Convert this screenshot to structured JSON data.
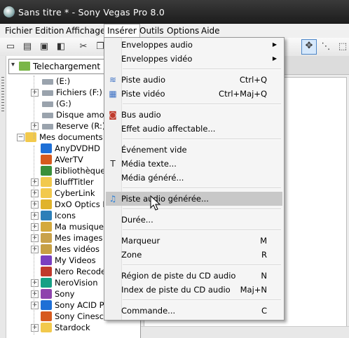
{
  "window": {
    "title": "Sans titre * - Sony Vegas Pro 8.0"
  },
  "menubar": [
    "Fichier",
    "Edition",
    "Affichage",
    "Insérer",
    "Outils",
    "Options",
    "Aide"
  ],
  "location": {
    "value": "Telechargement"
  },
  "tree": [
    {
      "label": "(E:)",
      "icon": "drive-icon",
      "expand": ""
    },
    {
      "label": "Fichiers (F:)",
      "icon": "drive-icon",
      "expand": "+"
    },
    {
      "label": "(G:)",
      "icon": "drive-icon",
      "expand": ""
    },
    {
      "label": "Disque amovi",
      "icon": "drive-icon",
      "expand": ""
    },
    {
      "label": "Reserve (R:)",
      "icon": "drive-icon",
      "expand": "+"
    },
    {
      "label": "Mes documents",
      "icon": "folder-icon",
      "expand": "-"
    },
    {
      "label": "AnyDVDHD",
      "icon": "app-icon",
      "expand": ""
    },
    {
      "label": "AVerTV",
      "icon": "app-icon",
      "expand": ""
    },
    {
      "label": "Bibliothèques",
      "icon": "app-icon",
      "expand": ""
    },
    {
      "label": "BluffTitler",
      "icon": "folder-icon",
      "expand": "+"
    },
    {
      "label": "CyberLink",
      "icon": "folder-icon",
      "expand": "+"
    },
    {
      "label": "DxO Optics P",
      "icon": "app-icon",
      "expand": "+"
    },
    {
      "label": "Icons",
      "icon": "app-icon",
      "expand": "+"
    },
    {
      "label": "Ma musique",
      "icon": "music-folder-icon",
      "expand": "+"
    },
    {
      "label": "Mes images",
      "icon": "pictures-folder-icon",
      "expand": "+"
    },
    {
      "label": "Mes vidéos",
      "icon": "videos-folder-icon",
      "expand": "+"
    },
    {
      "label": "My Videos",
      "icon": "app-icon",
      "expand": ""
    },
    {
      "label": "Nero Recode",
      "icon": "app-icon",
      "expand": ""
    },
    {
      "label": "NeroVision",
      "icon": "app-icon",
      "expand": "+"
    },
    {
      "label": "Sony",
      "icon": "app-icon",
      "expand": "+"
    },
    {
      "label": "Sony ACID Pr",
      "icon": "app-icon",
      "expand": "+"
    },
    {
      "label": "Sony Cinesco",
      "icon": "app-icon",
      "expand": ""
    },
    {
      "label": "Stardock",
      "icon": "folder-icon",
      "expand": "+"
    }
  ],
  "menu": {
    "items": [
      {
        "label": "Enveloppes audio",
        "shortcut": "",
        "submenu": true,
        "icon": ""
      },
      {
        "label": "Enveloppes vidéo",
        "shortcut": "",
        "submenu": true,
        "icon": ""
      },
      {
        "sep": true
      },
      {
        "label": "Piste audio",
        "shortcut": "Ctrl+Q",
        "icon": "audio-track-icon"
      },
      {
        "label": "Piste vidéo",
        "shortcut": "Ctrl+Maj+Q",
        "icon": "video-track-icon"
      },
      {
        "sep": true
      },
      {
        "label": "Bus audio",
        "shortcut": "",
        "icon": "audio-bus-icon"
      },
      {
        "label": "Effet audio affectable...",
        "shortcut": "",
        "icon": ""
      },
      {
        "sep": true
      },
      {
        "label": "Événement vide",
        "shortcut": "",
        "icon": ""
      },
      {
        "label": "Média texte...",
        "shortcut": "",
        "icon": "text-media-icon"
      },
      {
        "label": "Média généré...",
        "shortcut": "",
        "icon": ""
      },
      {
        "sep": true
      },
      {
        "label": "Piste audio générée...",
        "shortcut": "",
        "icon": "music-note-icon",
        "highlighted": true
      },
      {
        "sep": true
      },
      {
        "label": "Durée...",
        "shortcut": "",
        "icon": ""
      },
      {
        "sep": true
      },
      {
        "label": "Marqueur",
        "shortcut": "M",
        "icon": ""
      },
      {
        "label": "Zone",
        "shortcut": "R",
        "icon": ""
      },
      {
        "sep": true
      },
      {
        "label": "Région de piste du CD audio",
        "shortcut": "N",
        "icon": ""
      },
      {
        "label": "Index de piste du CD audio",
        "shortcut": "Maj+N",
        "icon": ""
      },
      {
        "sep": true
      },
      {
        "label": "Commande...",
        "shortcut": "C",
        "icon": ""
      }
    ]
  },
  "colors": {
    "titlebar": "#2a2a2a",
    "highlight": "#c8c8c8",
    "folder": "#f2c94c"
  }
}
